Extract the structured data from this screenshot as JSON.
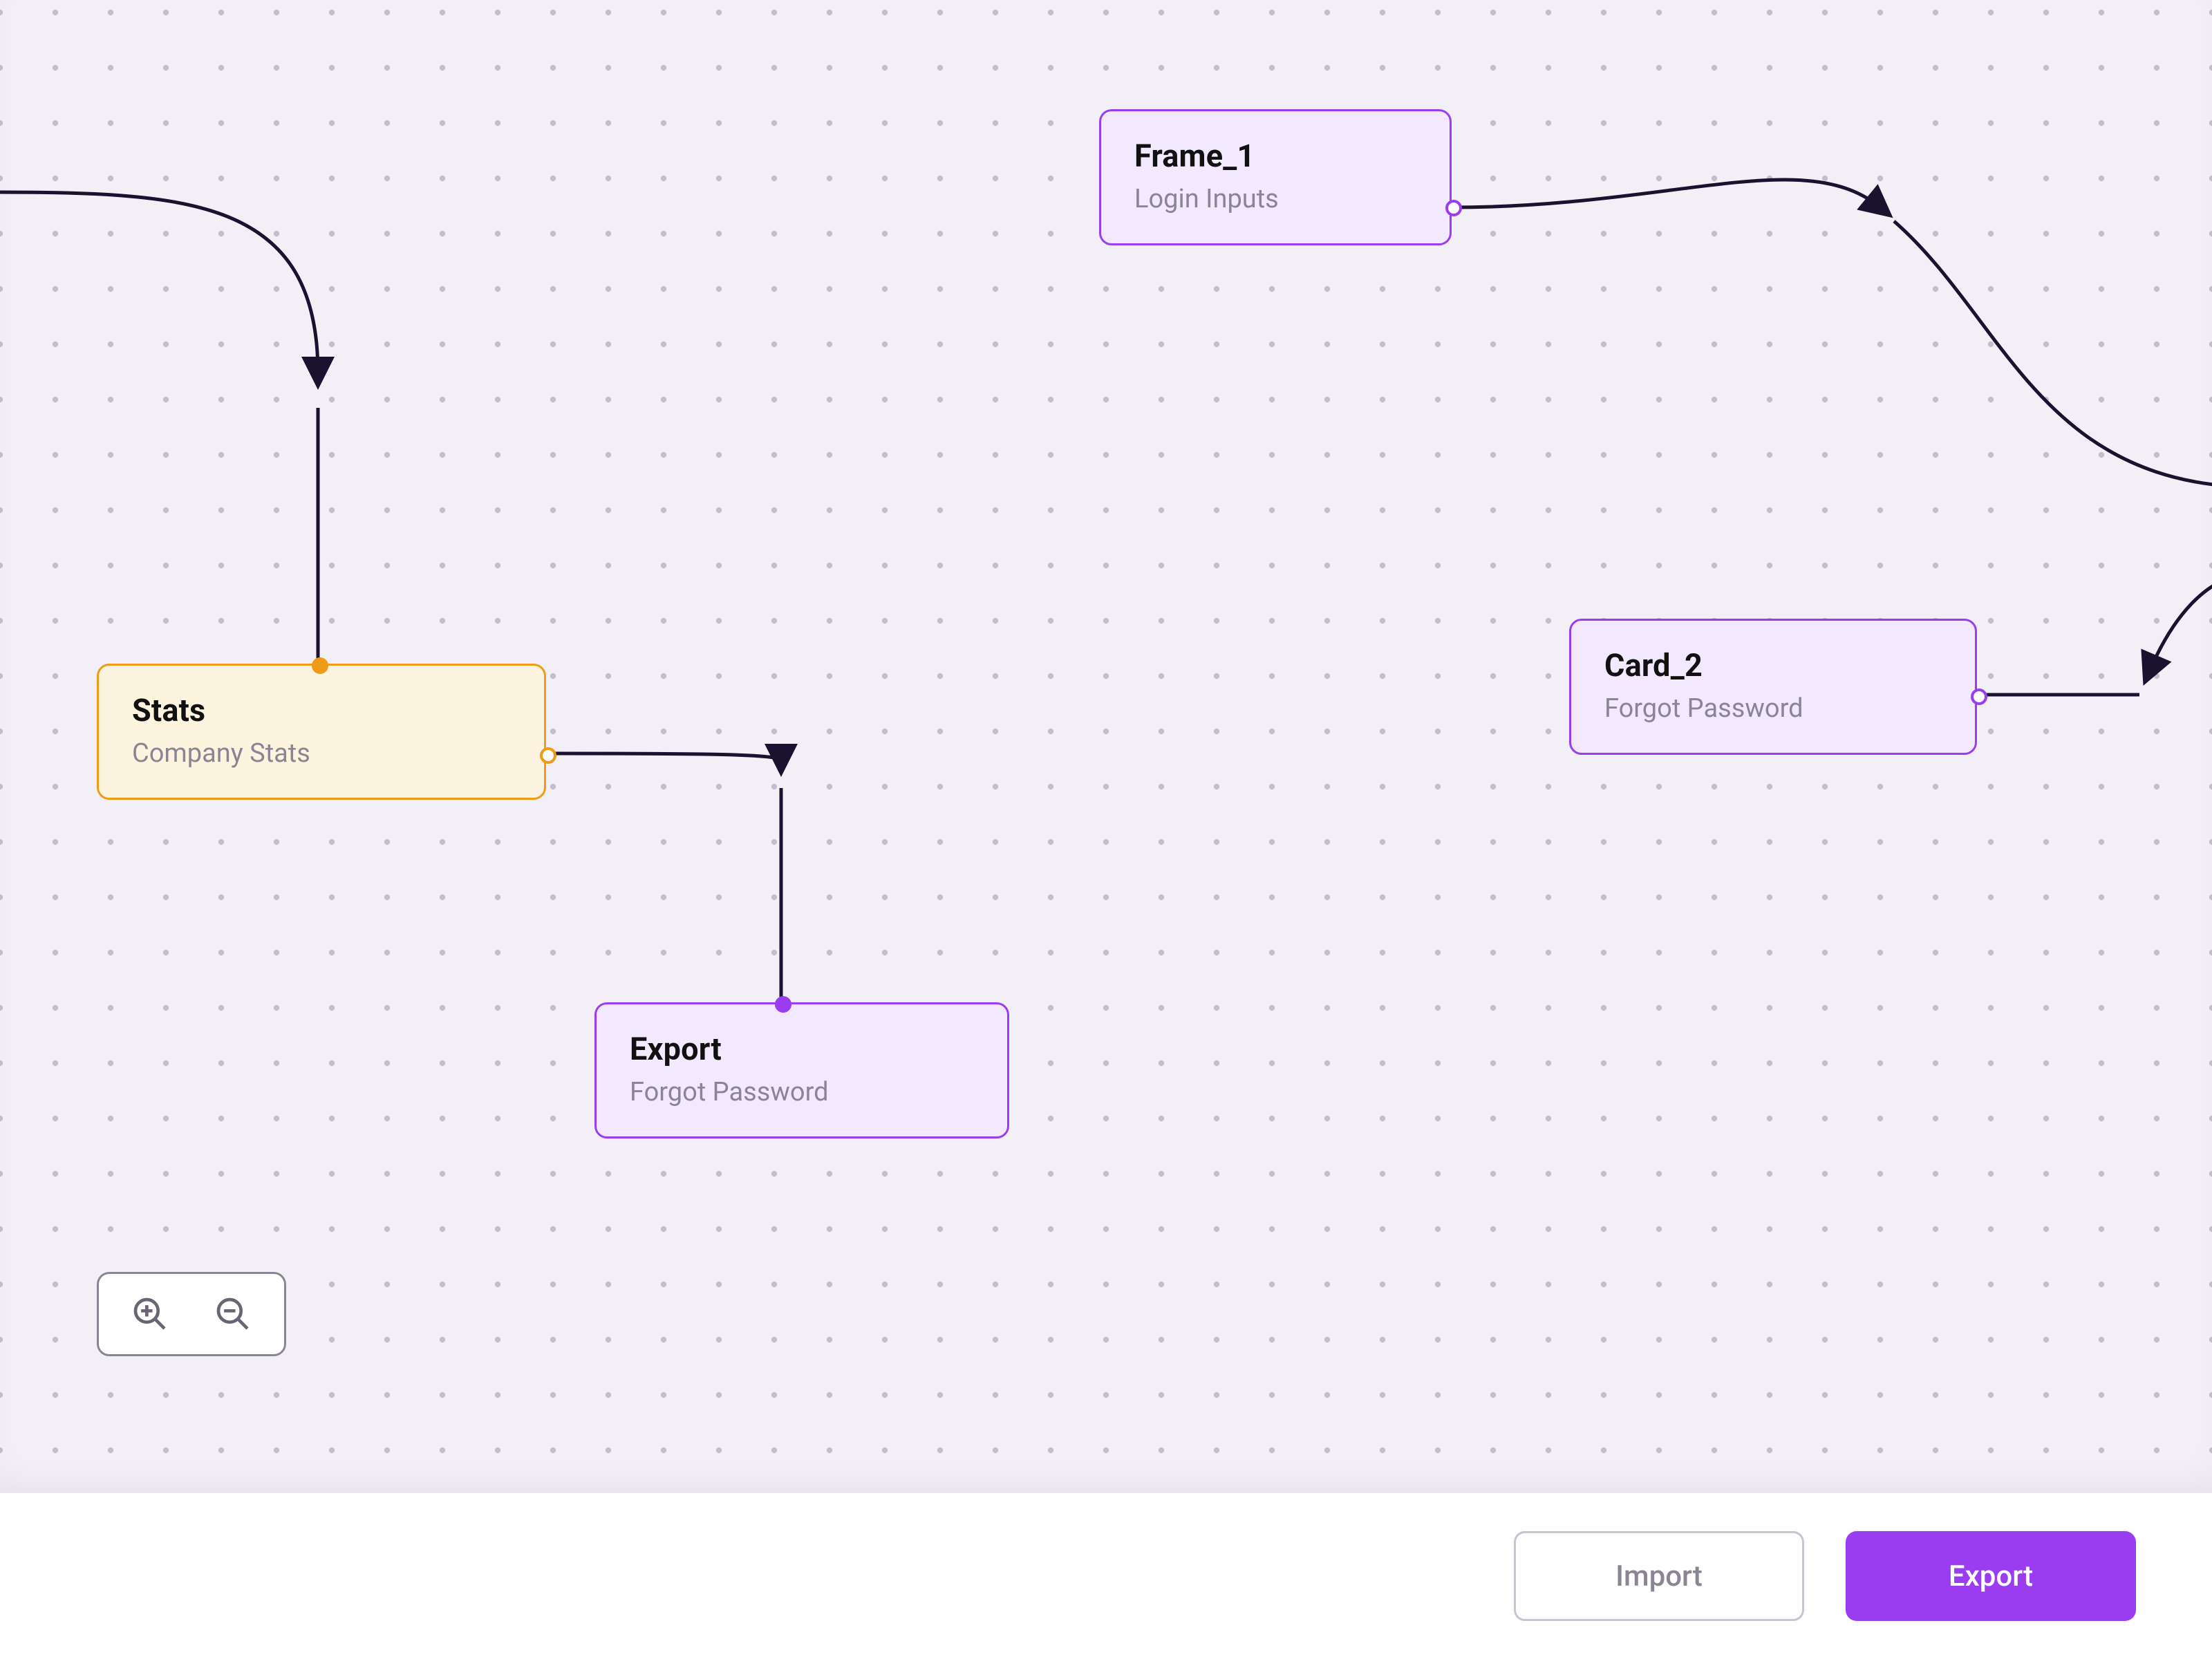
{
  "colors": {
    "accent_purple": "#9a3df0",
    "accent_orange": "#f09a1a",
    "canvas_bg": "#f2f0f6",
    "dot": "#c3bdd2",
    "text_muted": "#8b8593",
    "text_strong": "#111111",
    "connector": "#1a1330"
  },
  "nodes": {
    "stats": {
      "title": "Stats",
      "subtitle": "Company Stats"
    },
    "export": {
      "title": "Export",
      "subtitle": "Forgot Password"
    },
    "frame1": {
      "title": "Frame_1",
      "subtitle": "Login Inputs"
    },
    "card2": {
      "title": "Card_2",
      "subtitle": "Forgot Password"
    }
  },
  "toolbox": {
    "zoom_in": "zoom-in",
    "zoom_out": "zoom-out"
  },
  "footer": {
    "import_label": "Import",
    "export_label": "Export"
  }
}
